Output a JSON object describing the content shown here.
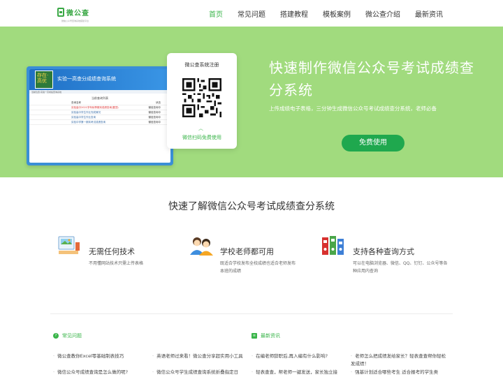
{
  "header": {
    "logo_text": "微公查",
    "logo_sub": "微信公众号查询系统搭建平台",
    "nav": [
      "首页",
      "常见问题",
      "搭建教程",
      "模板案例",
      "微公查介绍",
      "最新资讯"
    ]
  },
  "hero": {
    "title": "快速制作微信公众号考试成绩查分系统",
    "desc": "上传成绩电子表格，三分钟生成微信公众号考试成绩查分系统，老师必备",
    "button": "免费使用",
    "qr_title": "微公查系统注册",
    "qr_caption": "微信扫码免费使用",
    "mock": {
      "badge": "存在·高优",
      "title": "实验一高查分成绩查询系统",
      "subbar": "当前位置:实验一高成绩查询系统",
      "table_title": "当前查询列表",
      "rows": [
        {
          "name": "查询名称",
          "status": "状态"
        },
        {
          "name": "实验高中2021学年秋季期末成绩查询(置顶)",
          "status": "微信查询中"
        },
        {
          "name": "实验高中学生作业完成情况",
          "status": "微信查询中"
        },
        {
          "name": "实验高中学生作业查询",
          "status": "微信查询中"
        },
        {
          "name": "实验中学第一期末考试成绩查询",
          "status": "微信查询中"
        }
      ]
    }
  },
  "section_title": "快速了解微信公众号考试成绩查分系统",
  "features": [
    {
      "title": "无需任何技术",
      "desc": "不用懂网站技术只需上传表格",
      "icon": "computer-icon"
    },
    {
      "title": "学校老师都可用",
      "desc": "既适合学校发布全校成绩也适合老师发布本班的成绩",
      "icon": "teachers-icon"
    },
    {
      "title": "支持各种查询方式",
      "desc": "可以在电脑浏览器、微信、QQ、钉钉、公众号等各种应用内查询",
      "icon": "binders-icon"
    }
  ],
  "news": {
    "faq_title": "常见问题",
    "latest_title": "最新资讯",
    "faq_items": [
      "微公查教你Excel零基础制表技巧",
      "英语老师过来看！微公查分享超实用小工具",
      "微信公众号成绩查询是怎么做的呢?",
      "微信公众号学生成绩查询系统折叠指定日"
    ],
    "latest_items": [
      "在编老师辞职后,再入编有什么影响?",
      "老师怎么把成绩发给家长？轻表查查帮你轻松发成绩！",
      "轻表查查，帮老师一键发送，家长独立接",
      "强基计划适合哪些考生 适合报考的学生类"
    ]
  },
  "colors": {
    "accent": "#3ab54a",
    "hero_bg": "#a1db7e",
    "button": "#1fa84e"
  }
}
